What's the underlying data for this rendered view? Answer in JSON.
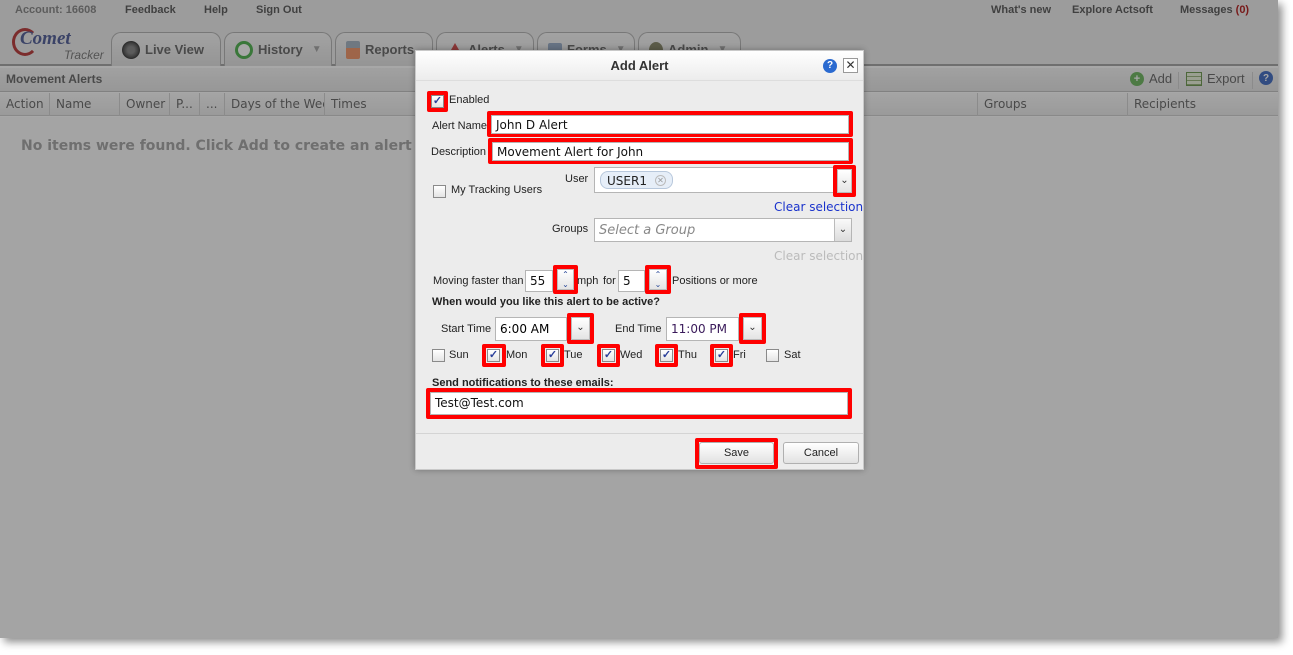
{
  "topbar": {
    "account": "Account: 16608",
    "feedback": "Feedback",
    "help": "Help",
    "sign_out": "Sign Out",
    "whats_new": "What's new",
    "explore": "Explore Actsoft",
    "messages_label": "Messages",
    "messages_count": "(0)"
  },
  "logo": {
    "main": "Comet",
    "sub": "Tracker"
  },
  "tabs": [
    {
      "label": "Live View",
      "icon": "speedometer-icon",
      "dropdown": false
    },
    {
      "label": "History",
      "icon": "clock-icon",
      "dropdown": true
    },
    {
      "label": "Reports",
      "icon": "report-icon",
      "dropdown": false
    },
    {
      "label": "Alerts",
      "icon": "alert-icon",
      "dropdown": true,
      "active": true
    },
    {
      "label": "Forms",
      "icon": "form-icon",
      "dropdown": true
    },
    {
      "label": "Admin",
      "icon": "admin-icon",
      "dropdown": true
    }
  ],
  "page": {
    "title": "Movement Alerts",
    "add_label": "Add",
    "export_label": "Export",
    "empty_message": "No items were found. Click Add to create an alert"
  },
  "table": {
    "columns": [
      "Action",
      "Name",
      "Owner",
      "P...",
      "...",
      "Days of the Week",
      "Times",
      "Groups",
      "Recipients"
    ]
  },
  "dialog": {
    "title": "Add Alert",
    "enabled_label": "Enabled",
    "enabled": true,
    "alert_name_label": "Alert Name",
    "alert_name": "John D Alert",
    "description_label": "Description",
    "description": "Movement Alert for John",
    "my_tracking_users_label": "My Tracking Users",
    "my_tracking_users": false,
    "user_label": "User",
    "users_selected": [
      "USER1"
    ],
    "clear_selection": "Clear selection",
    "groups_label": "Groups",
    "groups_placeholder": "Select a Group",
    "moving_faster_label": "Moving faster than",
    "speed": "55",
    "mph_label": "mph",
    "for_label": "for",
    "positions": "5",
    "positions_label": "Positions or more",
    "active_question": "When would you like this alert to be active?",
    "start_time_label": "Start Time",
    "start_time": "6:00 AM",
    "end_time_label": "End Time",
    "end_time": "11:00 PM",
    "days": [
      {
        "label": "Sun",
        "checked": false
      },
      {
        "label": "Mon",
        "checked": true
      },
      {
        "label": "Tue",
        "checked": true
      },
      {
        "label": "Wed",
        "checked": true
      },
      {
        "label": "Thu",
        "checked": true
      },
      {
        "label": "Fri",
        "checked": true
      },
      {
        "label": "Sat",
        "checked": false
      }
    ],
    "emails_label": "Send notifications to these emails:",
    "emails": "Test@Test.com",
    "save_label": "Save",
    "cancel_label": "Cancel"
  },
  "colors": {
    "highlight": "#ff0000",
    "link": "#1a33cc",
    "messages_count": "#aa0000"
  }
}
